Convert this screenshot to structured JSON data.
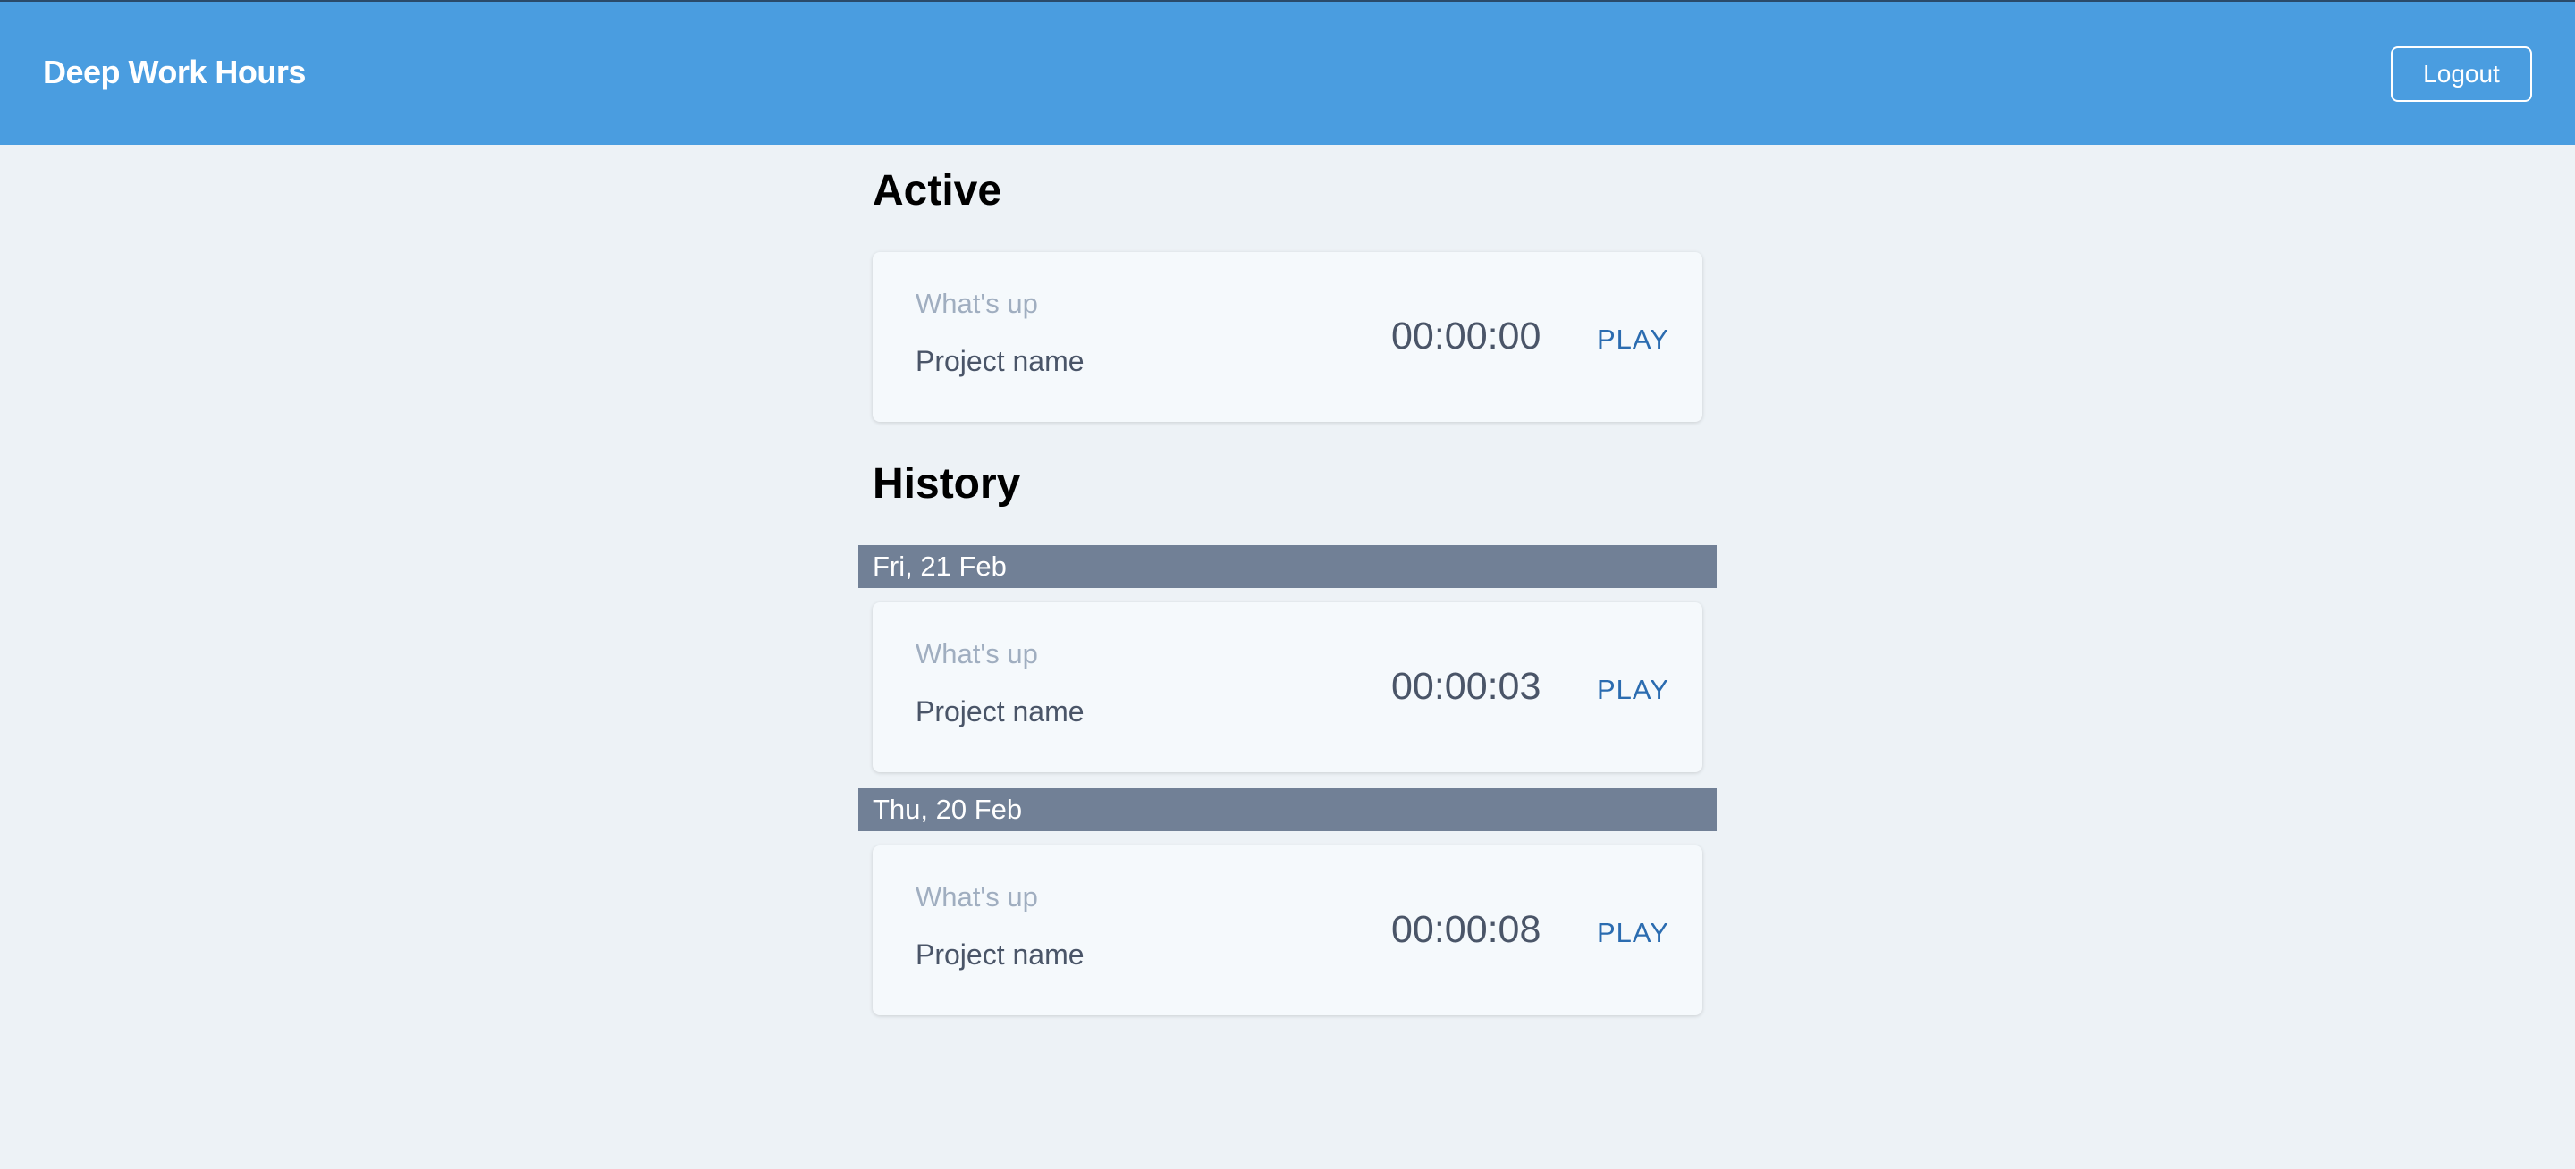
{
  "header": {
    "title": "Deep Work Hours",
    "logout_label": "Logout"
  },
  "active": {
    "heading": "Active",
    "entry": {
      "description_placeholder": "What's up",
      "project": "Project name",
      "timer": "00:00:00",
      "play_label": "PLAY"
    }
  },
  "history": {
    "heading": "History",
    "groups": [
      {
        "date": "Fri, 21 Feb",
        "entry": {
          "description_placeholder": "What's up",
          "project": "Project name",
          "timer": "00:00:03",
          "play_label": "PLAY"
        }
      },
      {
        "date": "Thu, 20 Feb",
        "entry": {
          "description_placeholder": "What's up",
          "project": "Project name",
          "timer": "00:00:08",
          "play_label": "PLAY"
        }
      }
    ]
  },
  "colors": {
    "header_bg": "#4a9de0",
    "page_bg": "#edf2f6",
    "date_bar_bg": "#718096",
    "play_link": "#2b6cb0"
  }
}
